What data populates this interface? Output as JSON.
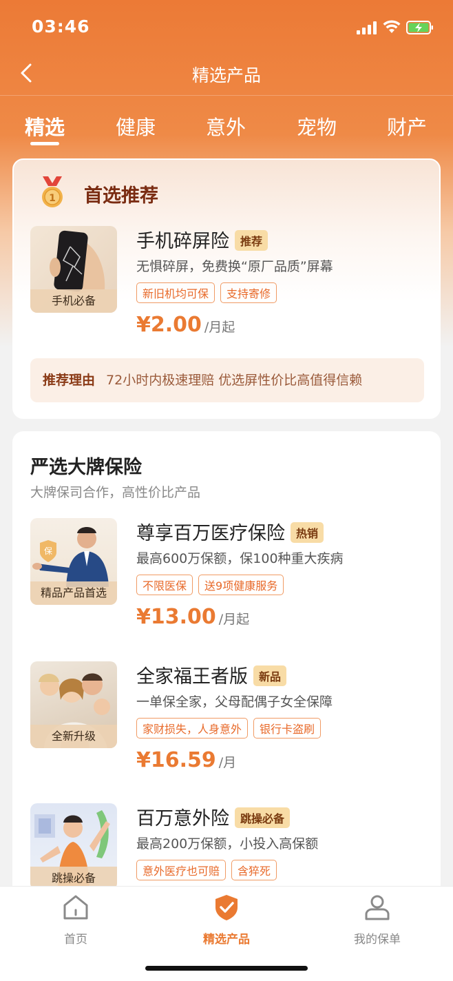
{
  "status": {
    "time": "03:46"
  },
  "nav": {
    "title": "精选产品"
  },
  "tabs": [
    "精选",
    "健康",
    "意外",
    "宠物",
    "财产"
  ],
  "recommend": {
    "title": "首选推荐",
    "product": {
      "thumb_label": "手机必备",
      "title": "手机碎屏险",
      "badge": "推荐",
      "desc": "无惧碎屏，免费换“原厂品质”屏幕",
      "tags": [
        "新旧机均可保",
        "支持寄修"
      ],
      "price": "¥2.00",
      "unit": "/月起"
    },
    "reason_label": "推荐理由",
    "reason_text": "72小时内极速理赔 优选屏性价比高值得信赖"
  },
  "brand": {
    "title": "严选大牌保险",
    "subtitle": "大牌保司合作，高性价比产品",
    "products": [
      {
        "thumb_label": "精品产品首选",
        "title": "尊享百万医疗保险",
        "badge": "热销",
        "desc": "最高600万保额，保100种重大疾病",
        "tags": [
          "不限医保",
          "送9项健康服务"
        ],
        "price": "¥13.00",
        "unit": "/月起"
      },
      {
        "thumb_label": "全新升级",
        "title": "全家福王者版",
        "badge": "新品",
        "desc": "一单保全家，父母配偶子女全保障",
        "tags": [
          "家财损失，人身意外",
          "银行卡盗刷"
        ],
        "price": "¥16.59",
        "unit": "/月"
      },
      {
        "thumb_label": "跳操必备",
        "title": "百万意外险",
        "badge": "跳操必备",
        "desc": "最高200万保额，小投入高保额",
        "tags": [
          "意外医疗也可赔",
          "含猝死"
        ]
      }
    ]
  },
  "tabbar": [
    "首页",
    "精选产品",
    "我的保单"
  ],
  "colors": {
    "brand_orange": "#ec7a36",
    "price": "#ea7a32",
    "badge_bg": "#f8dca6"
  }
}
